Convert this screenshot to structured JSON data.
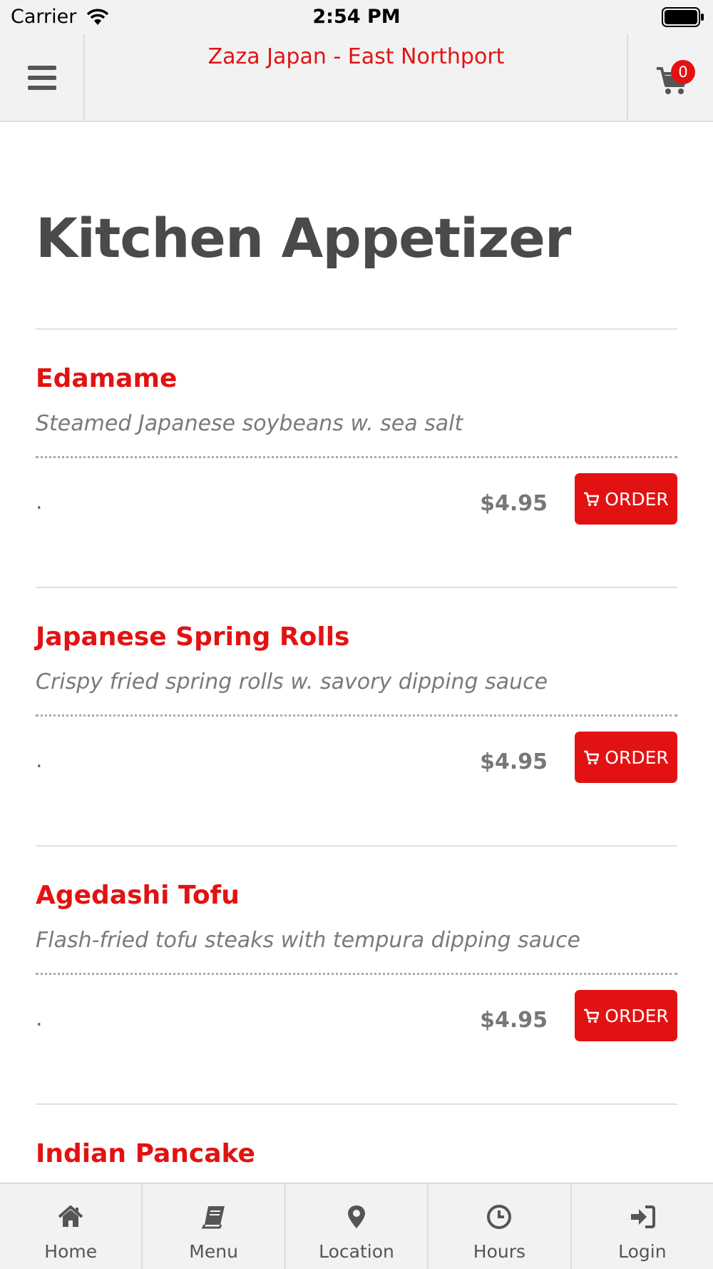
{
  "status_bar": {
    "carrier": "Carrier",
    "time": "2:54 PM"
  },
  "header": {
    "title": "Zaza Japan - East Northport",
    "cart_count": "0"
  },
  "category": {
    "title": "Kitchen Appetizer"
  },
  "items": [
    {
      "name": "Edamame",
      "description": "Steamed Japanese soybeans w. sea salt",
      "dot": ".",
      "price": "$4.95",
      "order_label": "ORDER"
    },
    {
      "name": "Japanese Spring Rolls",
      "description": "Crispy fried spring rolls w. savory dipping sauce",
      "dot": ".",
      "price": "$4.95",
      "order_label": "ORDER"
    },
    {
      "name": "Agedashi Tofu",
      "description": "Flash-fried tofu steaks with tempura dipping sauce",
      "dot": ".",
      "price": "$4.95",
      "order_label": "ORDER"
    },
    {
      "name": "Indian Pancake"
    }
  ],
  "tabs": [
    {
      "label": "Home",
      "icon": "home-icon"
    },
    {
      "label": "Menu",
      "icon": "book-icon"
    },
    {
      "label": "Location",
      "icon": "map-marker-icon"
    },
    {
      "label": "Hours",
      "icon": "clock-icon"
    },
    {
      "label": "Login",
      "icon": "sign-in-icon"
    }
  ],
  "colors": {
    "accent": "#e31212",
    "bar_bg": "#f2f2f2",
    "heading": "#4a4a4a"
  }
}
